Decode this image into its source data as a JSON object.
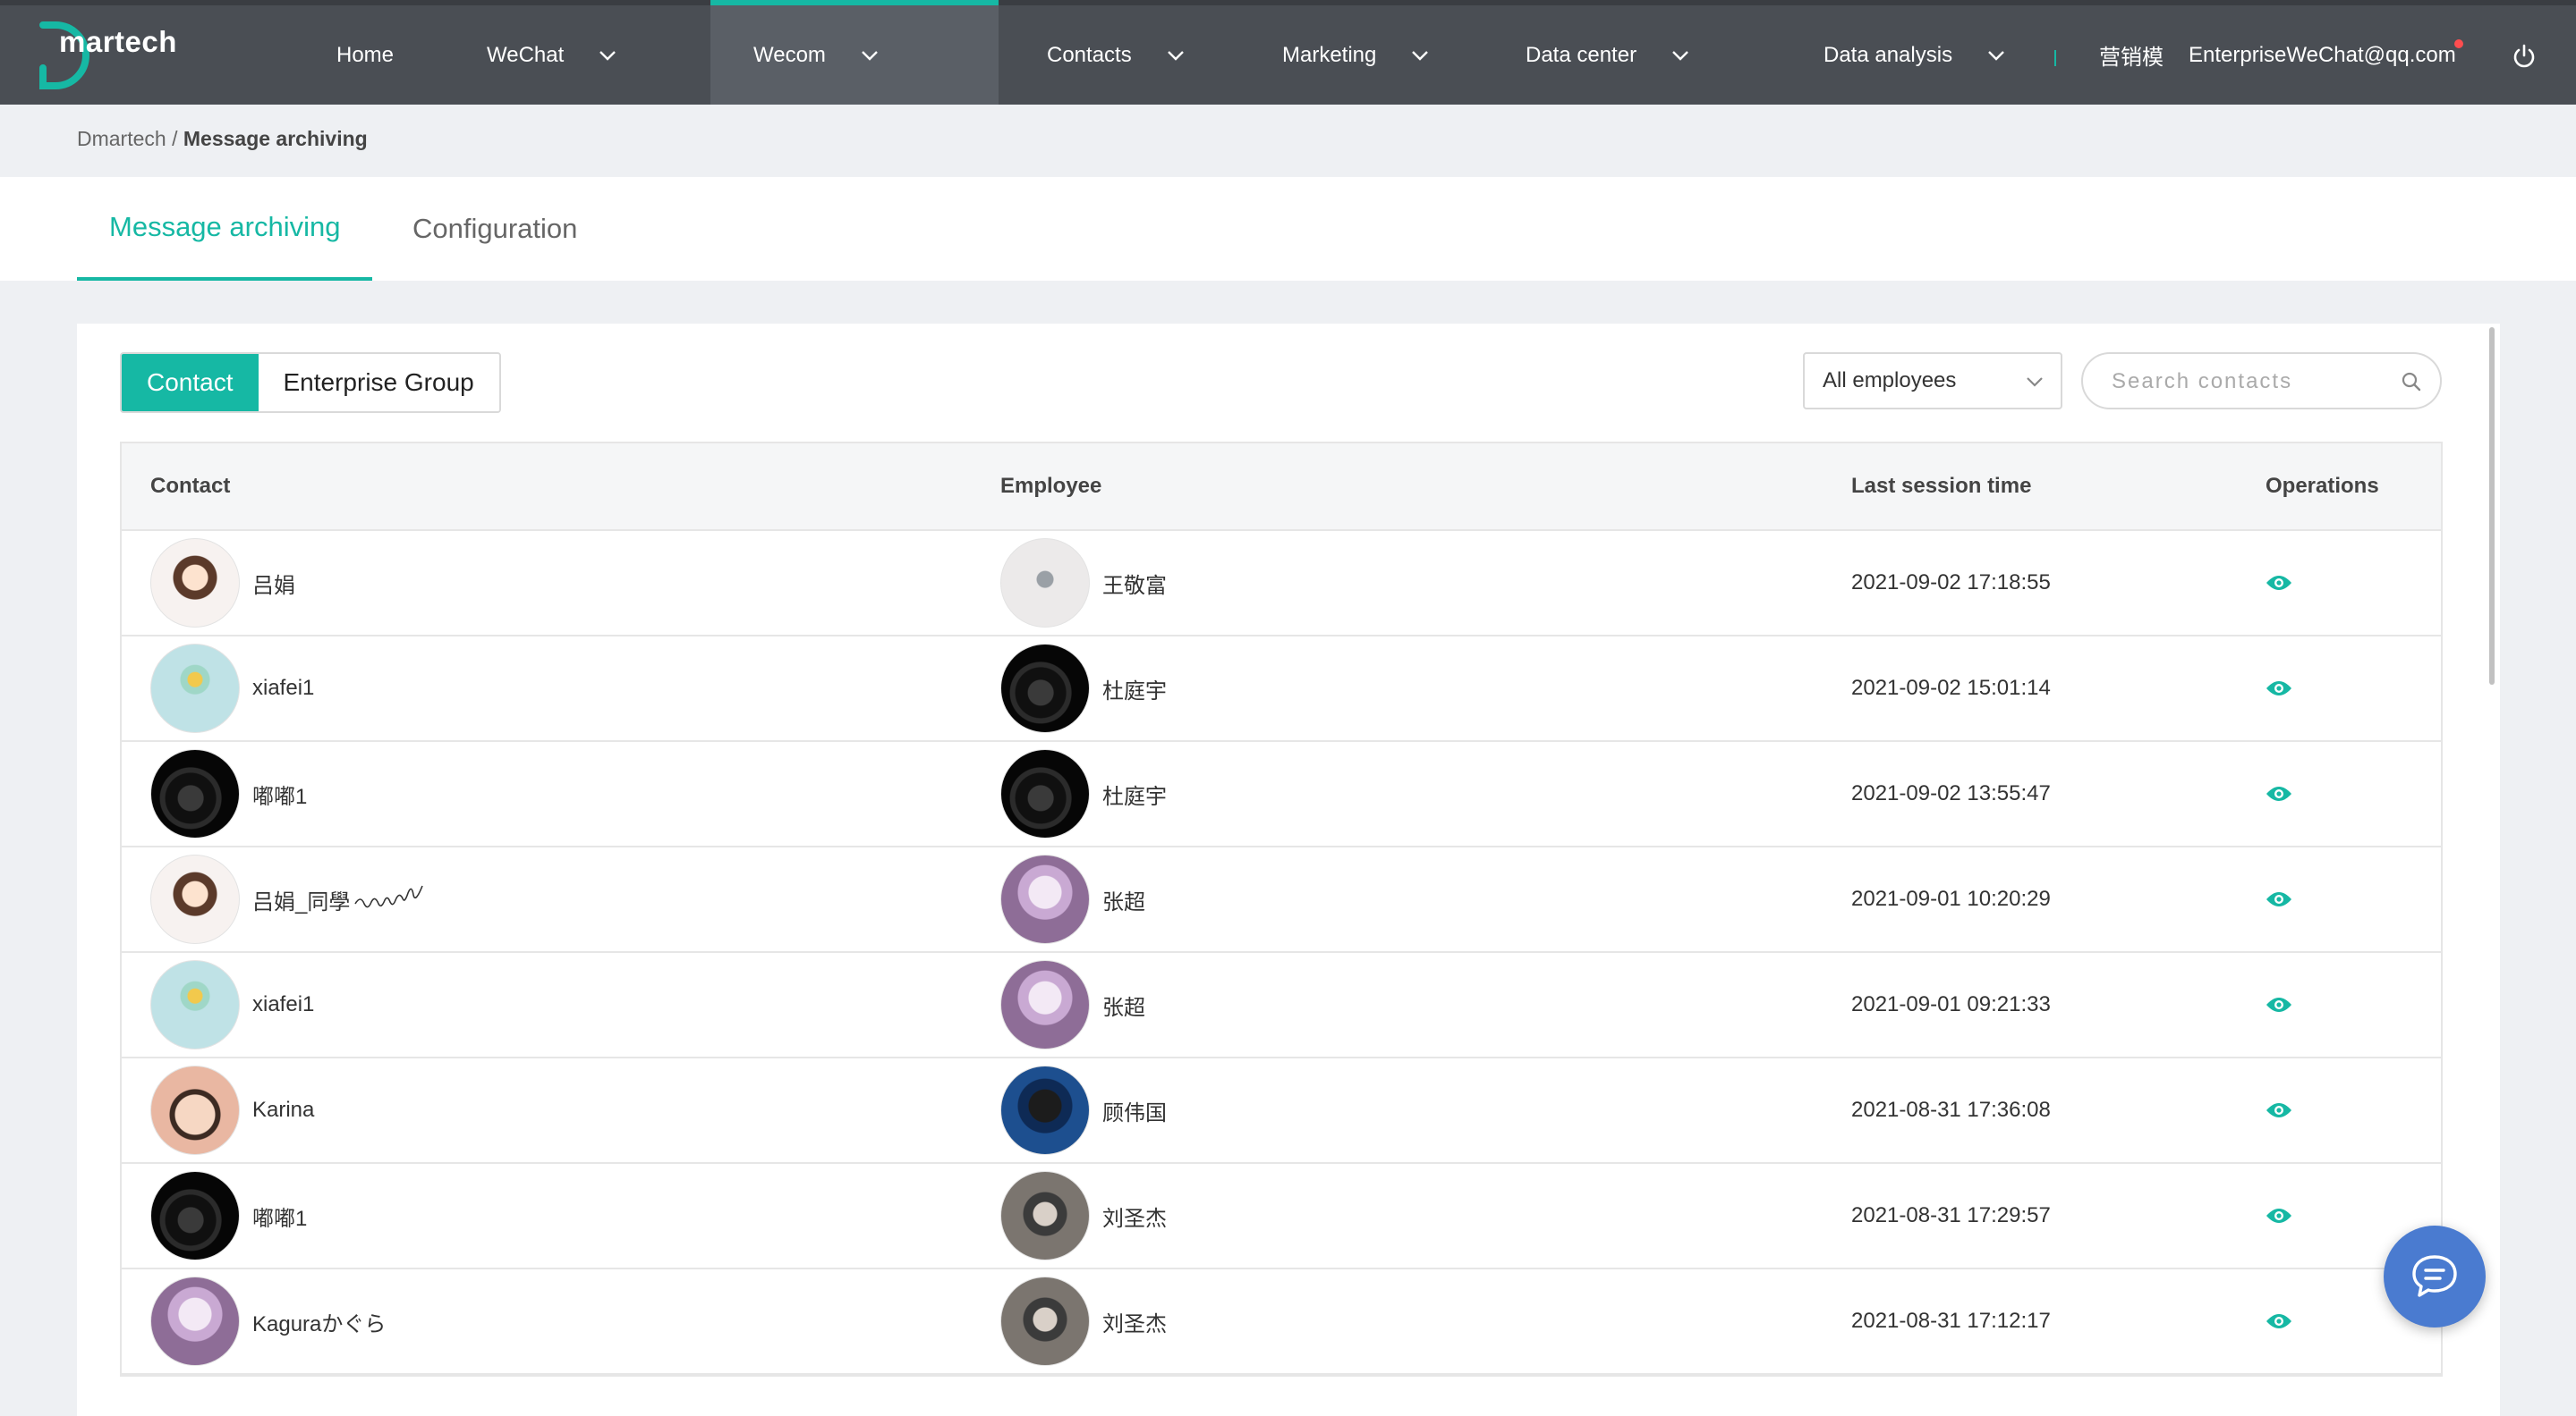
{
  "brand": {
    "name": "martech",
    "accent": "#16b8a4",
    "nav_bg": "#4a4e54",
    "fab_color": "#4a7bd0"
  },
  "nav": {
    "home": "Home",
    "wechat": "WeChat",
    "wecom": "Wecom",
    "contacts": "Contacts",
    "marketing": "Marketing",
    "data_center": "Data center",
    "data_analysis": "Data analysis",
    "org_name": "营销模",
    "account": "EnterpriseWeChat@qq.com"
  },
  "breadcrumb": {
    "root": "Dmartech",
    "separator": " / ",
    "current": "Message archiving"
  },
  "tabs": {
    "active": "Message archiving",
    "other": "Configuration"
  },
  "toggle": {
    "contact": "Contact",
    "group": "Enterprise Group",
    "selected": "Contact"
  },
  "filter": {
    "employees": "All employees"
  },
  "search": {
    "placeholder": "Search contacts"
  },
  "table": {
    "headers": [
      "Contact",
      "Employee",
      "Last session time",
      "Operations"
    ],
    "rows": [
      {
        "contact": "吕娟",
        "contact_avatar": "girl-avatar",
        "employee": "王敬富",
        "employee_avatar": "robot-avatar",
        "time": "2021-09-02 17:18:55"
      },
      {
        "contact": "xiafei1",
        "contact_avatar": "flower-avatar",
        "employee": "杜庭宇",
        "employee_avatar": "dark-avatar",
        "time": "2021-09-02 15:01:14"
      },
      {
        "contact": "嘟嘟1",
        "contact_avatar": "dark-avatar",
        "employee": "杜庭宇",
        "employee_avatar": "dark-avatar",
        "time": "2021-09-02 13:55:47"
      },
      {
        "contact": "吕娟_同學",
        "contact_avatar": "girl-avatar",
        "employee": "张超",
        "employee_avatar": "cake-avatar",
        "time": "2021-09-01 10:20:29"
      },
      {
        "contact": "xiafei1",
        "contact_avatar": "flower-avatar",
        "employee": "张超",
        "employee_avatar": "cake-avatar",
        "time": "2021-09-01 09:21:33"
      },
      {
        "contact": "Karina",
        "contact_avatar": "baby-avatar",
        "employee": "顾伟国",
        "employee_avatar": "vader-avatar",
        "time": "2021-08-31 17:36:08"
      },
      {
        "contact": "嘟嘟1",
        "contact_avatar": "dark-avatar",
        "employee": "刘圣杰",
        "employee_avatar": "man-avatar",
        "time": "2021-08-31 17:29:57"
      },
      {
        "contact": "Kaguraかぐら",
        "contact_avatar": "cake-avatar",
        "employee": "刘圣杰",
        "employee_avatar": "man-avatar",
        "time": "2021-08-31 17:12:17"
      }
    ]
  },
  "icons": {
    "view": "eye-icon",
    "search": "search-icon",
    "power": "power-icon",
    "chat": "chat-bubble-icon",
    "dropdown": "chevron-down-icon"
  }
}
